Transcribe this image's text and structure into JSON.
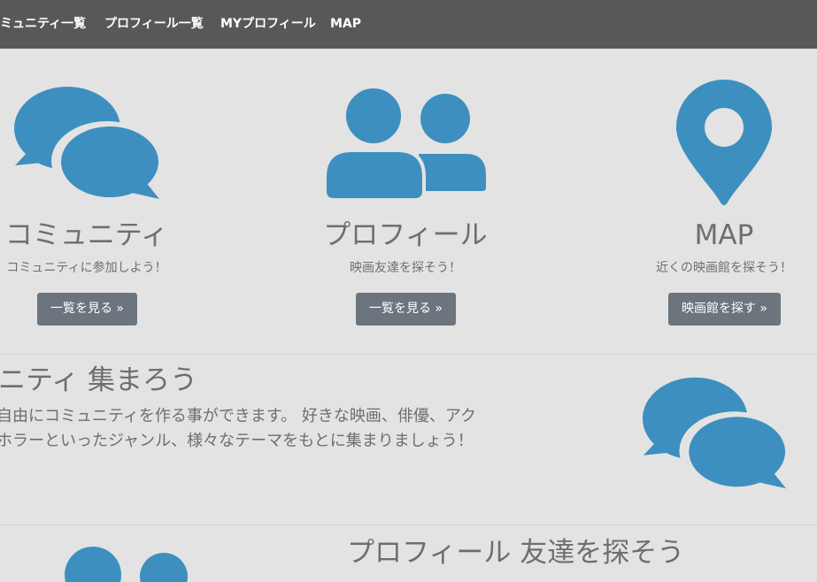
{
  "navbar": {
    "links": [
      "ミュニティ一覧",
      "プロフィール一覧",
      "MYプロフィール",
      "MAP"
    ]
  },
  "features": [
    {
      "icon": "chat-bubbles-icon",
      "title": "コミュニティ",
      "description": "コミュニティに参加しよう！",
      "button": "一覧を見る »"
    },
    {
      "icon": "users-icon",
      "title": "プロフィール",
      "description": "映画友達を探そう！",
      "button": "一覧を見る »"
    },
    {
      "icon": "map-marker-icon",
      "title": "MAP",
      "description": "近くの映画館を探そう！",
      "button": "映画館を探す »"
    }
  ],
  "community_section": {
    "heading": "ニティ 集まろう",
    "text_line1": "自由にコミュニティを作る事ができます。 好きな映画、俳優、アク",
    "text_line2": "ホラーといったジャンル、様々なテーマをもとに集まりましょう！",
    "icon": "chat-bubbles-icon"
  },
  "profile_section": {
    "heading": "プロフィール 友達を探そう",
    "icon": "users-icon"
  },
  "colors": {
    "navbar": "#585858",
    "background": "#e3e3e3",
    "icon": "#3d8fbf",
    "button": "#6c757d"
  }
}
